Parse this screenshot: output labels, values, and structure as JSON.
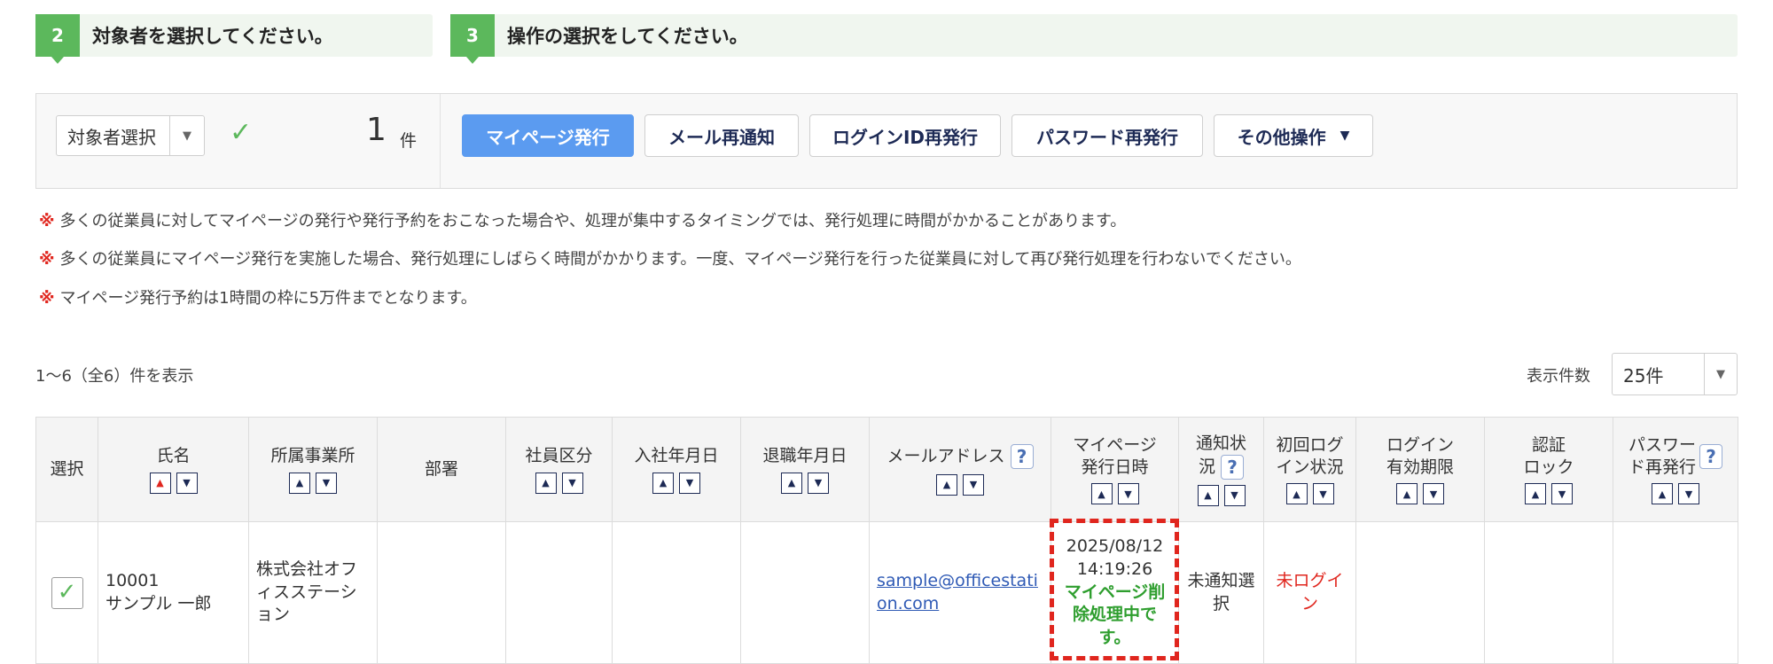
{
  "steps": [
    {
      "num": "2",
      "label": "対象者を選択してください。"
    },
    {
      "num": "3",
      "label": "操作の選択をしてください。"
    }
  ],
  "selection": {
    "dropdown_label": "対象者選択",
    "count": "1",
    "count_unit": "件"
  },
  "actions": {
    "mypage_issue": "マイページ発行",
    "mail_renotify": "メール再通知",
    "login_id_reissue": "ログインID再発行",
    "password_reissue": "パスワード再発行",
    "other_ops": "その他操作"
  },
  "notes": [
    "多くの従業員に対してマイページの発行や発行予約をおこなった場合や、処理が集中するタイミングでは、発行処理に時間がかかることがあります。",
    "多くの従業員にマイページ発行を実施した場合、発行処理にしばらく時間がかかります。一度、マイページ発行を行った従業員に対して再び発行処理を行わないでください。",
    "マイページ発行予約は1時間の枠に5万件までとなります。"
  ],
  "note_mark": "※",
  "list": {
    "range_text": "1～6（全6）件を表示",
    "per_page_label": "表示件数",
    "per_page_value": "25件"
  },
  "table": {
    "headers": {
      "select": "選択",
      "name": "氏名",
      "office": "所属事業所",
      "dept": "部署",
      "emp_type": "社員区分",
      "join_date": "入社年月日",
      "leave_date": "退職年月日",
      "email": "メールアドレス",
      "mypage_date_1": "マイページ",
      "mypage_date_2": "発行日時",
      "notify_1": "通知状",
      "notify_2": "況",
      "first_login_1": "初回ログ",
      "first_login_2": "イン状況",
      "login_expiry_1": "ログイン",
      "login_expiry_2": "有効期限",
      "auth_lock_1": "認証",
      "auth_lock_2": "ロック",
      "pw_reissue_1": "パスワー",
      "pw_reissue_2": "ド再発行"
    },
    "row": {
      "emp_no": "10001",
      "name": "サンプル 一郎",
      "office": "株式会社オフィスステーション",
      "email": "sample@officestation.com",
      "issue_date": "2025/08/12",
      "issue_time": "14:19:26",
      "issue_status": "マイページ削除処理中です。",
      "notify_status": "未通知選択",
      "first_login": "未ログイン"
    }
  },
  "colors": {
    "accent_green": "#5cb85c",
    "primary_blue": "#5b9bf0",
    "alert_red": "#e0261e"
  },
  "icons": {
    "check": "check-icon",
    "caret": "chevron-down-icon",
    "help": "help-icon",
    "sort_up": "sort-asc-icon",
    "sort_down": "sort-desc-icon"
  }
}
